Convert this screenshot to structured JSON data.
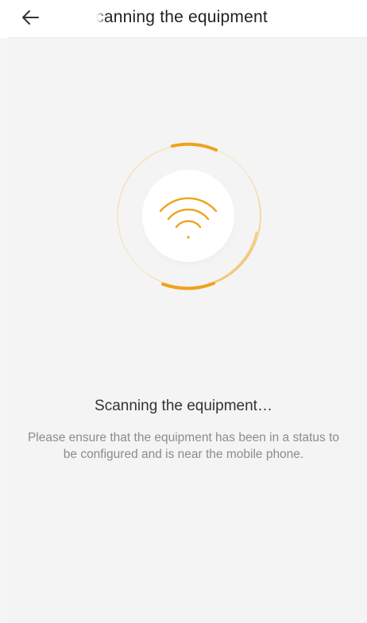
{
  "header": {
    "title": "Scanning the equipment",
    "back_icon": "arrow-left-icon"
  },
  "scanner": {
    "icon": "wifi-icon",
    "accent_color": "#F0A21C"
  },
  "status": {
    "title": "Scanning the equipment…",
    "description_line1": "Please ensure that the equipment has been in a status to",
    "description_line2": "be configured and is near the mobile phone."
  }
}
